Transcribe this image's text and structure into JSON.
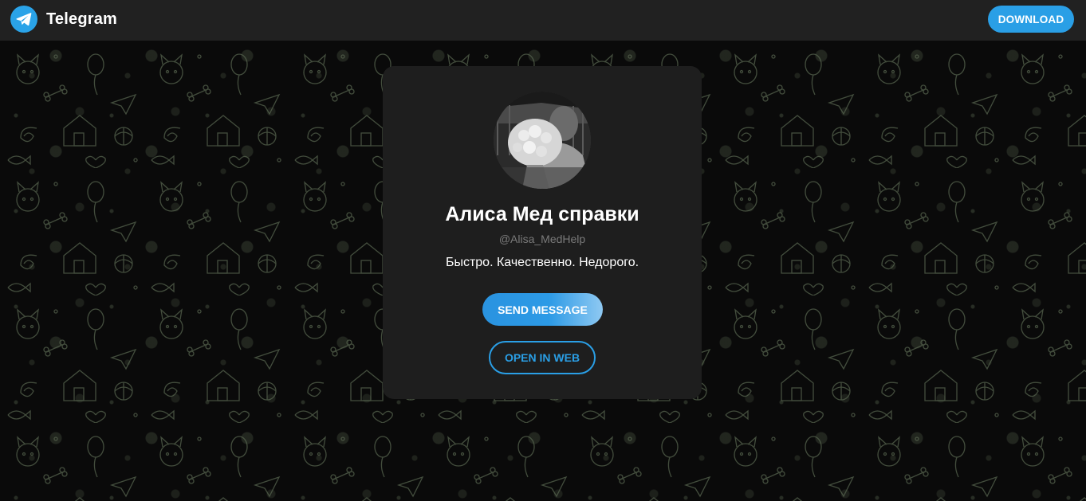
{
  "header": {
    "brand": "Telegram",
    "download_label": "DOWNLOAD",
    "accent_color": "#2aa3e8"
  },
  "profile": {
    "name": "Алиса Мед справки",
    "username": "@Alisa_MedHelp",
    "bio": "Быстро. Качественно. Недорого.",
    "avatar_icon": "profile-photo"
  },
  "actions": {
    "send_message_label": "SEND MESSAGE",
    "open_in_web_label": "OPEN IN WEB"
  },
  "background": {
    "pattern": "doodle-pattern",
    "color": "#0a0a0a",
    "pattern_color": "#5f6e55"
  }
}
